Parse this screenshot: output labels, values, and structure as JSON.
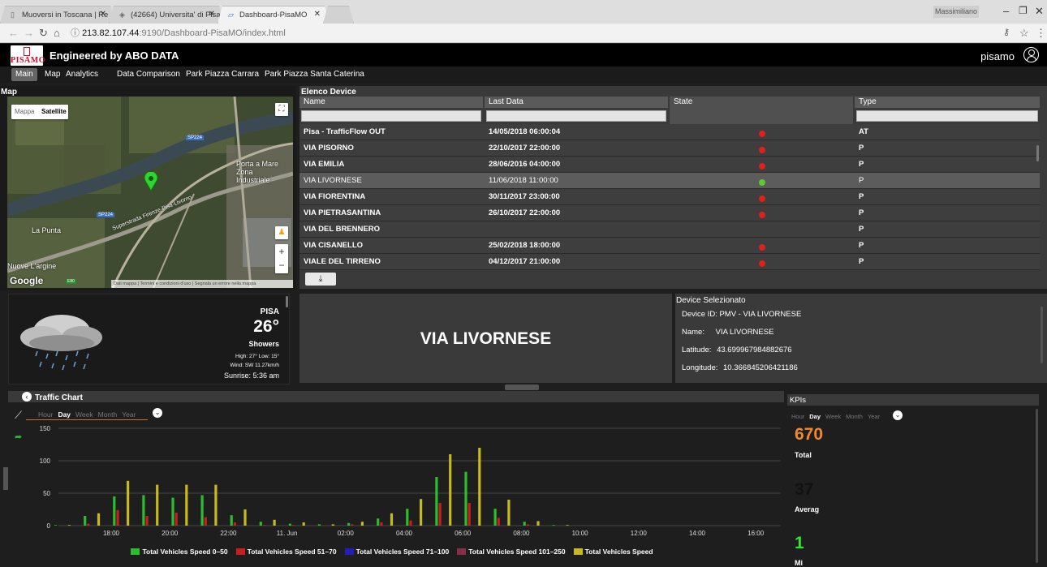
{
  "browser": {
    "tabs": [
      {
        "label": "Muoversi in Toscana | Re",
        "icon": "page-icon"
      },
      {
        "label": "(42664) Universita' di Pisa",
        "icon": "web-icon"
      },
      {
        "label": "Dashboard-PisaMO",
        "icon": "dashboard-icon"
      }
    ],
    "user": "Massimiliano",
    "url_host": "213.82.107.44",
    "url_path": ":9190/Dashboard-PisaMO/index.html"
  },
  "app": {
    "logo_text": "PISAMO",
    "brand": "Engineered by ABO DATA",
    "user": "pisamo",
    "menu": [
      "Main",
      "Map",
      "Analytics",
      "Data Comparison",
      "Park Piazza Carrara",
      "Park Piazza Santa Caterina"
    ]
  },
  "map": {
    "title": "Map",
    "type_buttons": [
      "Mappa",
      "Satellite"
    ],
    "labels": [
      "SP224",
      "SP224",
      "Porta a Mare Zona Industriale",
      "La Punta",
      "Superstrada Firenze-Pisa-Livorno",
      "Nuove L'argine",
      "E80"
    ],
    "google": "Google",
    "footer": "Dati mappa | Termini e condizioni d'uso | Segnala un errore nella mappa"
  },
  "devices": {
    "title": "Elenco Device",
    "columns": [
      "Name",
      "Last Data",
      "State",
      "Type"
    ],
    "rows": [
      {
        "name": "Pisa - TrafficFlow OUT",
        "last": "14/05/2018 06:00:04",
        "state": "red",
        "type": "AT"
      },
      {
        "name": "VIA PISORNO",
        "last": "22/10/2017 22:00:00",
        "state": "red",
        "type": "P"
      },
      {
        "name": "VIA EMILIA",
        "last": "28/06/2016 04:00:00",
        "state": "red",
        "type": "P"
      },
      {
        "name": "VIA LIVORNESE",
        "last": "11/06/2018 11:00:00",
        "state": "green",
        "type": "P"
      },
      {
        "name": "VIA FIORENTINA",
        "last": "30/11/2017 23:00:00",
        "state": "red",
        "type": "P"
      },
      {
        "name": "VIA PIETRASANTINA",
        "last": "26/10/2017 22:00:00",
        "state": "red",
        "type": "P"
      },
      {
        "name": "VIA DEL BRENNERO",
        "last": "",
        "state": "",
        "type": "P"
      },
      {
        "name": "VIA CISANELLO",
        "last": "25/02/2018 18:00:00",
        "state": "red",
        "type": "P"
      },
      {
        "name": "VIALE DEL TIRRENO",
        "last": "04/12/2017 21:00:00",
        "state": "red",
        "type": "P"
      }
    ],
    "state_colors": {
      "red": "#e0201a",
      "green": "#5dcc2a"
    }
  },
  "weather": {
    "city": "PISA",
    "temp": "26°",
    "condition": "Showers",
    "high_low": "High: 27° Low: 15°",
    "wind": "Wind: SW 11.27km/h",
    "sunrise": "Sunrise: 5:36 am"
  },
  "selected": {
    "big_name": "VIA LIVORNESE",
    "title": "Device Selezionato",
    "id_line": "Device ID: PMV - VIA LIVORNESE",
    "name_label": "Name:",
    "name_value": "VIA LIVORNESE",
    "lat_label": "Latitude:",
    "lat_value": "43.699967984882676",
    "lon_label": "Longitude:",
    "lon_value": "10.366845206421186"
  },
  "traffic": {
    "title": "Traffic Chart",
    "periods": [
      "Hour",
      "Day",
      "Week",
      "Month",
      "Year"
    ],
    "active_period": "Day"
  },
  "chart_data": {
    "type": "bar",
    "ylim": [
      0,
      150
    ],
    "yticks": [
      "150",
      "100",
      "50",
      "0"
    ],
    "x_labels": [
      "18:00",
      "20:00",
      "22:00",
      "11. Jun",
      "02:00",
      "04:00",
      "06:00",
      "08:00",
      "10:00",
      "12:00",
      "14:00",
      "16:00"
    ],
    "series": [
      {
        "name": "Total Vehicles Speed 0–50",
        "color": "#2bbd2b",
        "values": [
          1,
          15,
          45,
          47,
          43,
          47,
          16,
          6,
          3,
          2,
          4,
          11,
          26,
          75,
          83,
          26,
          6,
          1
        ]
      },
      {
        "name": "Total Vehicles Speed 51–70",
        "color": "#c81e1e",
        "values": [
          0,
          3,
          24,
          15,
          20,
          13,
          5,
          1,
          1,
          0,
          2,
          5,
          8,
          35,
          35,
          12,
          2,
          0
        ]
      },
      {
        "name": "Total Vehicles Speed 71–100",
        "color": "#2020b8",
        "values": [
          0,
          0,
          0,
          0,
          0,
          0,
          0,
          0,
          0,
          0,
          0,
          0,
          0,
          0,
          0,
          0,
          0,
          0
        ]
      },
      {
        "name": "Total Vehicles Speed 101–250",
        "color": "#8a2d4a",
        "values": [
          0,
          0,
          0,
          0,
          0,
          0,
          0,
          0,
          0,
          0,
          0,
          0,
          0,
          0,
          0,
          0,
          0,
          0
        ]
      },
      {
        "name": "Total Vehicles Speed",
        "color": "#c8b820",
        "values": [
          1,
          19,
          69,
          63,
          63,
          63,
          25,
          9,
          5,
          2,
          6,
          19,
          41,
          110,
          120,
          40,
          7,
          1
        ]
      }
    ]
  },
  "kpis": {
    "title": "KPIs",
    "periods": [
      "Hour",
      "Day",
      "Week",
      "Month",
      "Year"
    ],
    "active_period": "Day",
    "total_value": "670",
    "total_label": "Total",
    "avg_value": "37",
    "avg_label": "Averag",
    "min_value": "1",
    "min_label": "Mi",
    "colors": {
      "total": "#f08a2a",
      "avg": "#111111",
      "min": "#2ee62e"
    }
  }
}
